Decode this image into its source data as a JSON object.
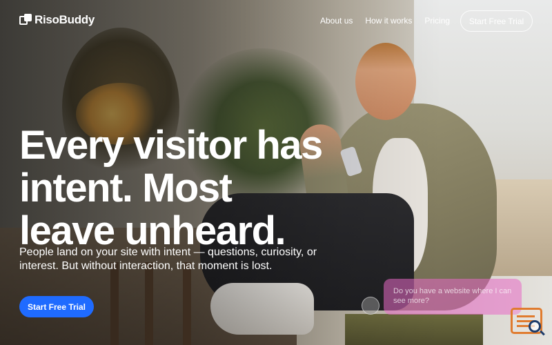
{
  "brand": {
    "name": "RisoBuddy",
    "logo_icon": "logo-mark-icon"
  },
  "nav": {
    "links": [
      "About us",
      "How it works",
      "Pricing"
    ],
    "cta_label": "Start Free Trial"
  },
  "hero": {
    "headline_lines": [
      "Every visitor has",
      "intent. Most",
      "leave unheard."
    ],
    "subtext_lines": [
      "People land on your site with intent — questions, curiosity, or",
      "interest. But without interaction, that moment is lost."
    ],
    "cta_label": "Start Free Trial"
  },
  "chat_preview": {
    "message_lines": [
      "Do you have a website where I can",
      "see more?"
    ]
  },
  "widget": {
    "icon": "document-search-icon",
    "colors": {
      "frame": "#e07b2e",
      "lens": "#1f3d6b"
    }
  },
  "colors": {
    "primary": "#1f6bff",
    "chat_bubble": "#e86ac6",
    "text": "#ffffff"
  }
}
